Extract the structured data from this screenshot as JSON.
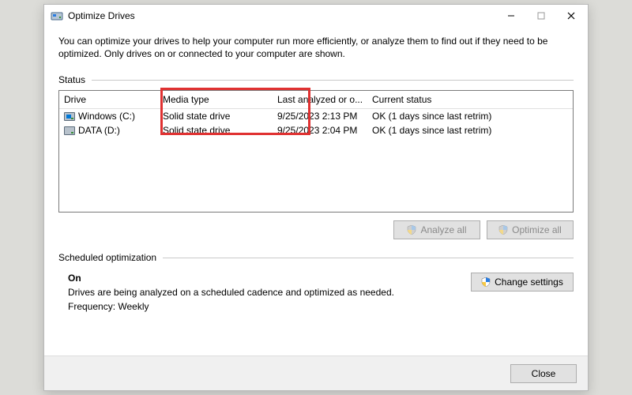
{
  "window": {
    "title": "Optimize Drives",
    "intro": "You can optimize your drives to help your computer run more efficiently, or analyze them to find out if they need to be optimized. Only drives on or connected to your computer are shown."
  },
  "status": {
    "label": "Status",
    "columns": {
      "drive": "Drive",
      "media": "Media type",
      "last": "Last analyzed or o...",
      "status": "Current status"
    },
    "rows": [
      {
        "drive": "Windows (C:)",
        "media": "Solid state drive",
        "last": "9/25/2023 2:13 PM",
        "status": "OK (1 days since last retrim)"
      },
      {
        "drive": "DATA (D:)",
        "media": "Solid state drive",
        "last": "9/25/2023 2:04 PM",
        "status": "OK (1 days since last retrim)"
      }
    ]
  },
  "buttons": {
    "analyze_all": "Analyze all",
    "optimize_all": "Optimize all",
    "change_settings": "Change settings",
    "close": "Close"
  },
  "scheduled": {
    "label": "Scheduled optimization",
    "on": "On",
    "desc": "Drives are being analyzed on a scheduled cadence and optimized as needed.",
    "freq_label": "Frequency:",
    "freq_value": "Weekly"
  }
}
